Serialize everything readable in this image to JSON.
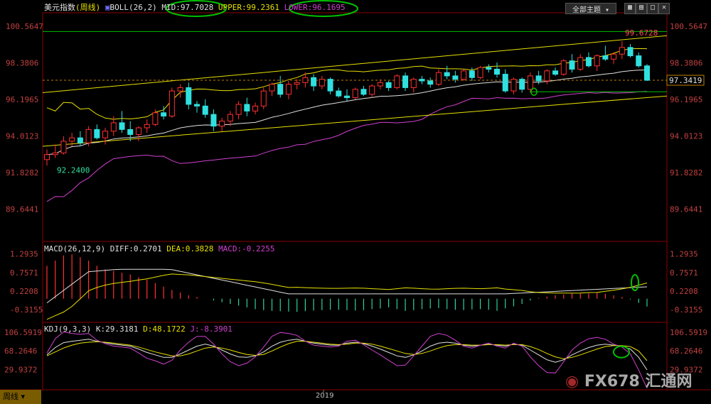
{
  "header": {
    "symbol": "美元指数",
    "period": "(周线)",
    "indicator": "BOLL(26,2)",
    "mid": "MID:97.7028",
    "upper": "UPPER:99.2361",
    "lower": "LOWER:96.1695",
    "theme_button": "全部主题",
    "colors": {
      "mid": "#e0e0e0",
      "upper": "#e8e000",
      "lower": "#d040d0",
      "highlight": "#00c000"
    }
  },
  "main_axis": {
    "left_ticks": [
      "100.5647",
      "98.3806",
      "96.1965",
      "94.0123",
      "91.8282",
      "89.6441"
    ],
    "right_ticks": [
      "100.5647",
      "98.3806",
      "96.1965",
      "94.0123",
      "91.8282",
      "89.6441"
    ],
    "current_price": "97.3419",
    "high_label": "99.6728",
    "low_label": "92.2400"
  },
  "macd": {
    "title": "MACD(26,12,9)",
    "diff": "DIFF:0.2701",
    "dea": "DEA:0.3828",
    "macd": "MACD:-0.2255",
    "ticks": [
      "1.2935",
      "0.7571",
      "0.2208",
      "-0.3155"
    ]
  },
  "kdj": {
    "title": "KDJ(9,3,3)",
    "k": "K:29.3181",
    "d": "D:48.1722",
    "j": "J:-8.3901",
    "ticks": [
      "106.5919",
      "68.2646",
      "29.9372"
    ]
  },
  "footer": {
    "tab": "周线",
    "year": "2019",
    "watermark": "FX678 汇通网"
  },
  "chart_data": [
    {
      "type": "candlestick",
      "title": "美元指数 (周线)",
      "ylim": [
        87.8,
        101.2
      ],
      "candles": [
        [
          92.6,
          93.2,
          92.24,
          92.9
        ],
        [
          92.9,
          93.5,
          92.7,
          93.0
        ],
        [
          93.0,
          94.0,
          92.9,
          93.7
        ],
        [
          93.7,
          94.2,
          93.4,
          93.9
        ],
        [
          93.9,
          94.3,
          93.4,
          93.6
        ],
        [
          93.6,
          94.6,
          93.4,
          94.4
        ],
        [
          94.4,
          94.7,
          93.8,
          93.9
        ],
        [
          93.9,
          94.5,
          93.5,
          94.3
        ],
        [
          94.3,
          95.2,
          94.0,
          94.8
        ],
        [
          94.8,
          95.5,
          94.2,
          94.4
        ],
        [
          94.4,
          94.9,
          93.7,
          94.1
        ],
        [
          94.1,
          94.6,
          93.7,
          94.5
        ],
        [
          94.5,
          95.0,
          94.2,
          94.7
        ],
        [
          94.7,
          95.6,
          94.6,
          95.4
        ],
        [
          95.4,
          95.8,
          95.0,
          95.2
        ],
        [
          95.2,
          96.9,
          95.1,
          96.7
        ],
        [
          96.7,
          97.1,
          96.3,
          96.9
        ],
        [
          96.9,
          97.2,
          95.6,
          95.9
        ],
        [
          95.9,
          96.1,
          95.4,
          95.8
        ],
        [
          95.8,
          96.2,
          95.1,
          95.3
        ],
        [
          95.3,
          95.6,
          94.3,
          94.6
        ],
        [
          94.6,
          95.1,
          94.3,
          94.9
        ],
        [
          94.9,
          95.5,
          94.6,
          95.3
        ],
        [
          95.3,
          96.1,
          95.0,
          95.9
        ],
        [
          95.9,
          96.3,
          95.2,
          95.5
        ],
        [
          95.5,
          96.0,
          95.3,
          95.8
        ],
        [
          95.8,
          96.9,
          95.6,
          96.7
        ],
        [
          96.7,
          97.2,
          96.4,
          97.1
        ],
        [
          97.1,
          97.6,
          96.3,
          96.5
        ],
        [
          96.5,
          97.3,
          96.2,
          97.1
        ],
        [
          97.1,
          97.4,
          96.8,
          97.2
        ],
        [
          97.2,
          97.8,
          96.9,
          97.5
        ],
        [
          97.5,
          97.7,
          96.7,
          97.0
        ],
        [
          97.0,
          97.6,
          96.8,
          97.4
        ],
        [
          97.4,
          97.5,
          96.5,
          96.7
        ],
        [
          96.7,
          96.9,
          96.3,
          96.4
        ],
        [
          96.4,
          96.8,
          96.1,
          96.3
        ],
        [
          96.3,
          96.9,
          96.2,
          96.8
        ],
        [
          96.8,
          97.0,
          96.4,
          96.5
        ],
        [
          96.5,
          97.1,
          96.3,
          97.0
        ],
        [
          97.0,
          97.4,
          96.8,
          97.2
        ],
        [
          97.2,
          97.3,
          96.7,
          96.9
        ],
        [
          96.9,
          97.7,
          96.8,
          97.6
        ],
        [
          97.6,
          97.8,
          96.7,
          96.9
        ],
        [
          96.9,
          97.5,
          96.6,
          97.4
        ],
        [
          97.4,
          97.6,
          97.1,
          97.3
        ],
        [
          97.3,
          97.5,
          96.9,
          97.1
        ],
        [
          97.1,
          98.0,
          97.0,
          97.8
        ],
        [
          97.8,
          98.2,
          97.4,
          97.6
        ],
        [
          97.6,
          97.9,
          97.2,
          97.4
        ],
        [
          97.4,
          98.0,
          97.3,
          97.9
        ],
        [
          97.9,
          98.1,
          97.3,
          97.5
        ],
        [
          97.5,
          98.2,
          97.4,
          98.1
        ],
        [
          98.1,
          98.3,
          97.8,
          98.0
        ],
        [
          98.0,
          98.4,
          97.5,
          97.7
        ],
        [
          97.7,
          98.0,
          96.6,
          96.7
        ],
        [
          96.7,
          97.5,
          96.5,
          97.4
        ],
        [
          97.4,
          97.5,
          96.6,
          96.8
        ],
        [
          96.8,
          97.8,
          96.6,
          97.6
        ],
        [
          97.6,
          97.9,
          97.1,
          97.3
        ],
        [
          97.3,
          98.0,
          97.1,
          97.9
        ],
        [
          97.9,
          98.1,
          97.6,
          97.7
        ],
        [
          97.7,
          98.6,
          97.6,
          98.5
        ],
        [
          98.5,
          98.9,
          97.8,
          98.0
        ],
        [
          98.0,
          98.9,
          97.9,
          98.7
        ],
        [
          98.7,
          99.0,
          98.1,
          98.2
        ],
        [
          98.2,
          98.9,
          97.9,
          98.8
        ],
        [
          98.8,
          99.4,
          98.5,
          98.6
        ],
        [
          98.6,
          99.0,
          98.3,
          98.9
        ],
        [
          98.9,
          99.67,
          98.6,
          99.3
        ],
        [
          99.3,
          99.5,
          98.7,
          98.8
        ],
        [
          98.8,
          99.0,
          98.1,
          98.2
        ],
        [
          98.2,
          98.3,
          97.3,
          97.34
        ]
      ]
    },
    {
      "type": "histogram",
      "title": "MACD(26,12,9)",
      "ylim": [
        -0.6,
        1.45
      ],
      "values": [
        0.95,
        1.1,
        1.25,
        1.28,
        1.2,
        1.1,
        0.95,
        0.85,
        0.8,
        0.75,
        0.7,
        0.62,
        0.55,
        0.45,
        0.35,
        0.25,
        0.18,
        0.1,
        0.05,
        0.0,
        -0.05,
        -0.1,
        -0.15,
        -0.2,
        -0.25,
        -0.3,
        -0.33,
        -0.35,
        -0.36,
        -0.37,
        -0.38,
        -0.36,
        -0.34,
        -0.33,
        -0.32,
        -0.32,
        -0.33,
        -0.34,
        -0.33,
        -0.3,
        -0.28,
        -0.25,
        -0.3,
        -0.35,
        -0.33,
        -0.3,
        -0.28,
        -0.27,
        -0.3,
        -0.32,
        -0.33,
        -0.31,
        -0.3,
        -0.32,
        -0.35,
        -0.28,
        -0.22,
        -0.15,
        -0.05,
        0.02,
        0.06,
        0.1,
        0.12,
        0.15,
        0.17,
        0.16,
        0.18,
        0.14,
        0.1,
        0.05,
        -0.02,
        -0.12,
        -0.2255
      ]
    },
    {
      "type": "line",
      "title": "KDJ(9,3,3)",
      "ylim": [
        -10,
        115
      ],
      "series": [
        {
          "name": "K",
          "color": "#e0e0e0",
          "values": [
            60,
            75,
            85,
            88,
            90,
            92,
            88,
            85,
            82,
            80,
            78,
            72,
            65,
            60,
            55,
            55,
            62,
            70,
            78,
            82,
            78,
            70,
            62,
            56,
            55,
            58,
            66,
            78,
            86,
            90,
            92,
            88,
            84,
            82,
            80,
            80,
            84,
            86,
            83,
            78,
            72,
            65,
            58,
            55,
            60,
            68,
            78,
            84,
            86,
            84,
            80,
            78,
            80,
            82,
            80,
            78,
            82,
            80,
            70,
            60,
            50,
            45,
            50,
            60,
            68,
            75,
            80,
            82,
            80,
            78,
            72,
            55,
            29.3
          ]
        },
        {
          "name": "D",
          "color": "#e8e000",
          "values": [
            58,
            66,
            74,
            80,
            84,
            86,
            87,
            86,
            84,
            82,
            80,
            76,
            71,
            66,
            62,
            58,
            58,
            62,
            68,
            74,
            76,
            74,
            70,
            65,
            61,
            59,
            61,
            68,
            76,
            83,
            88,
            88,
            86,
            84,
            82,
            81,
            82,
            84,
            84,
            82,
            78,
            73,
            68,
            63,
            61,
            63,
            68,
            74,
            79,
            81,
            81,
            80,
            80,
            81,
            81,
            80,
            81,
            81,
            77,
            71,
            63,
            56,
            52,
            55,
            60,
            66,
            72,
            77,
            79,
            79,
            77,
            68,
            48.2
          ]
        },
        {
          "name": "J",
          "color": "#d040d0",
          "values": [
            64,
            93,
            107,
            104,
            102,
            104,
            90,
            83,
            78,
            76,
            74,
            64,
            53,
            48,
            41,
            49,
            70,
            86,
            98,
            98,
            82,
            62,
            46,
            38,
            43,
            56,
            76,
            98,
            106,
            104,
            100,
            88,
            80,
            78,
            76,
            78,
            88,
            90,
            81,
            70,
            60,
            49,
            38,
            39,
            58,
            78,
            98,
            104,
            100,
            90,
            78,
            74,
            80,
            84,
            78,
            74,
            84,
            78,
            56,
            38,
            24,
            23,
            46,
            70,
            84,
            93,
            96,
            92,
            82,
            76,
            62,
            29,
            -8.4
          ]
        }
      ]
    }
  ]
}
